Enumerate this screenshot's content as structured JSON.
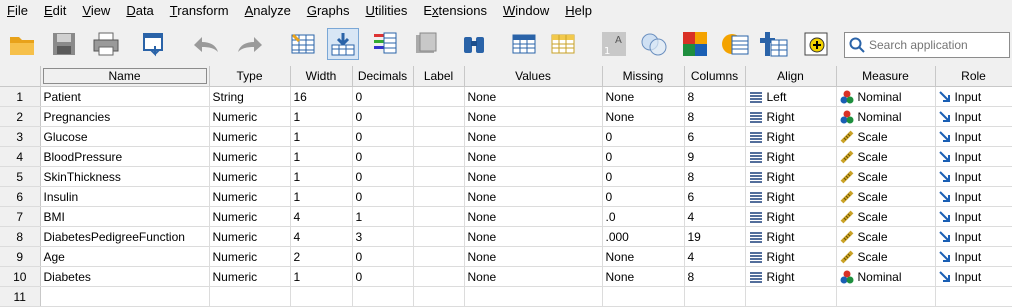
{
  "menubar": {
    "items": [
      {
        "label": "File",
        "ul": "F",
        "rest": "ile"
      },
      {
        "label": "Edit",
        "ul": "E",
        "rest": "dit"
      },
      {
        "label": "View",
        "ul": "V",
        "rest": "iew"
      },
      {
        "label": "Data",
        "ul": "D",
        "rest": "ata"
      },
      {
        "label": "Transform",
        "ul": "T",
        "rest": "ransform"
      },
      {
        "label": "Analyze",
        "ul": "A",
        "rest": "nalyze"
      },
      {
        "label": "Graphs",
        "ul": "G",
        "rest": "raphs"
      },
      {
        "label": "Utilities",
        "ul": "U",
        "rest": "tilities"
      },
      {
        "label": "Extensions",
        "ul": "x",
        "pre": "E",
        "rest": "tensions"
      },
      {
        "label": "Window",
        "ul": "W",
        "rest": "indow"
      },
      {
        "label": "Help",
        "ul": "H",
        "rest": "elp"
      }
    ]
  },
  "toolbar": {
    "search_placeholder": "Search application",
    "buttons": [
      "open-icon",
      "save-icon",
      "print-icon",
      "recall-dialog-icon",
      "undo-icon",
      "redo-icon",
      "goto-case-icon",
      "goto-variable-icon",
      "variables-icon",
      "run-descriptives-icon",
      "find-icon",
      "insert-cases-icon",
      "insert-variable-icon",
      "split-file-icon",
      "weight-cases-icon",
      "select-cases-icon",
      "value-labels-icon",
      "use-variable-sets-icon",
      "show-all-variables-icon",
      "spell-check-icon"
    ]
  },
  "grid": {
    "headers": [
      "Name",
      "Type",
      "Width",
      "Decimals",
      "Label",
      "Values",
      "Missing",
      "Columns",
      "Align",
      "Measure",
      "Role"
    ],
    "rows": [
      {
        "num": "1",
        "name": "Patient",
        "type": "String",
        "width": "16",
        "decimals": "0",
        "label": "",
        "values": "None",
        "missing": "None",
        "columns": "8",
        "align": "Left",
        "measure": "Nominal",
        "role": "Input"
      },
      {
        "num": "2",
        "name": "Pregnancies",
        "type": "Numeric",
        "width": "1",
        "decimals": "0",
        "label": "",
        "values": "None",
        "missing": "None",
        "columns": "8",
        "align": "Right",
        "measure": "Nominal",
        "role": "Input"
      },
      {
        "num": "3",
        "name": "Glucose",
        "type": "Numeric",
        "width": "1",
        "decimals": "0",
        "label": "",
        "values": "None",
        "missing": "0",
        "columns": "6",
        "align": "Right",
        "measure": "Scale",
        "role": "Input"
      },
      {
        "num": "4",
        "name": "BloodPressure",
        "type": "Numeric",
        "width": "1",
        "decimals": "0",
        "label": "",
        "values": "None",
        "missing": "0",
        "columns": "9",
        "align": "Right",
        "measure": "Scale",
        "role": "Input"
      },
      {
        "num": "5",
        "name": "SkinThickness",
        "type": "Numeric",
        "width": "1",
        "decimals": "0",
        "label": "",
        "values": "None",
        "missing": "0",
        "columns": "8",
        "align": "Right",
        "measure": "Scale",
        "role": "Input"
      },
      {
        "num": "6",
        "name": "Insulin",
        "type": "Numeric",
        "width": "1",
        "decimals": "0",
        "label": "",
        "values": "None",
        "missing": "0",
        "columns": "6",
        "align": "Right",
        "measure": "Scale",
        "role": "Input"
      },
      {
        "num": "7",
        "name": "BMI",
        "type": "Numeric",
        "width": "4",
        "decimals": "1",
        "label": "",
        "values": "None",
        "missing": ".0",
        "columns": "4",
        "align": "Right",
        "measure": "Scale",
        "role": "Input"
      },
      {
        "num": "8",
        "name": "DiabetesPedigreeFunction",
        "type": "Numeric",
        "width": "4",
        "decimals": "3",
        "label": "",
        "values": "None",
        "missing": ".000",
        "columns": "19",
        "align": "Right",
        "measure": "Scale",
        "role": "Input"
      },
      {
        "num": "9",
        "name": "Age",
        "type": "Numeric",
        "width": "2",
        "decimals": "0",
        "label": "",
        "values": "None",
        "missing": "None",
        "columns": "4",
        "align": "Right",
        "measure": "Scale",
        "role": "Input"
      },
      {
        "num": "10",
        "name": "Diabetes",
        "type": "Numeric",
        "width": "1",
        "decimals": "0",
        "label": "",
        "values": "None",
        "missing": "None",
        "columns": "8",
        "align": "Right",
        "measure": "Nominal",
        "role": "Input"
      },
      {
        "num": "11",
        "name": "",
        "type": "",
        "width": "",
        "decimals": "",
        "label": "",
        "values": "",
        "missing": "",
        "columns": "",
        "align": "",
        "measure": "",
        "role": ""
      }
    ]
  },
  "colors": {
    "accent": "#7aa7d6",
    "grid_line": "#dcdcdc",
    "header_bg": "#f0f0f0"
  }
}
